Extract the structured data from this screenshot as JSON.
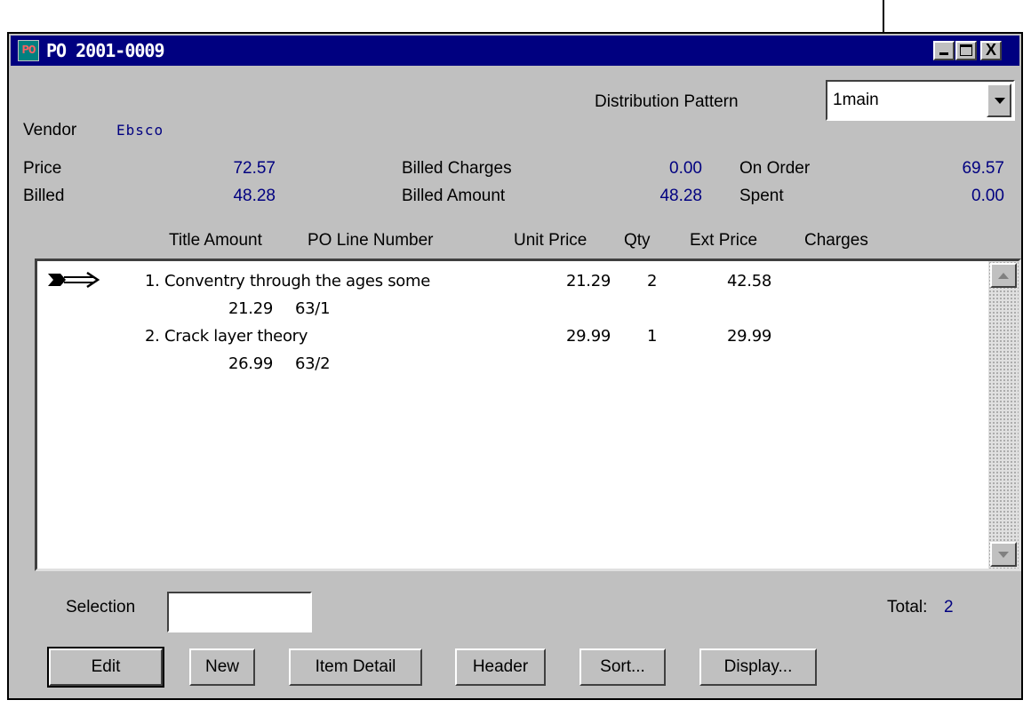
{
  "window": {
    "icon_text": "PO",
    "title": "PO 2001-0009",
    "close_glyph": "X"
  },
  "distribution": {
    "label": "Distribution Pattern",
    "value": "1main"
  },
  "vendor": {
    "label": "Vendor",
    "value": "Ebsco"
  },
  "summary": {
    "price_label": "Price",
    "price": "72.57",
    "billed_label": "Billed",
    "billed": "48.28",
    "billed_charges_label": "Billed Charges",
    "billed_charges": "0.00",
    "billed_amount_label": "Billed Amount",
    "billed_amount": "48.28",
    "on_order_label": "On Order",
    "on_order": "69.57",
    "spent_label": "Spent",
    "spent": "0.00"
  },
  "columns": {
    "title_amount": "Title Amount",
    "po_line": "PO Line Number",
    "unit_price": "Unit Price",
    "qty": "Qty",
    "ext_price": "Ext Price",
    "charges": "Charges"
  },
  "lines": [
    {
      "title": "1. Conventry through the ages some",
      "unit_price": "21.29",
      "qty": "2",
      "ext_price": "42.58",
      "amount": "21.29",
      "po_line": "63/1"
    },
    {
      "title": "2. Crack layer theory",
      "unit_price": "29.99",
      "qty": "1",
      "ext_price": "29.99",
      "amount": "26.99",
      "po_line": "63/2"
    }
  ],
  "selection": {
    "label": "Selection",
    "value": ""
  },
  "total": {
    "label": "Total:",
    "value": "2"
  },
  "buttons": {
    "edit": "Edit",
    "new": "New",
    "item_detail": "Item Detail",
    "header": "Header",
    "sort": "Sort...",
    "display": "Display..."
  },
  "colors": {
    "title_bar": "#000080",
    "value_text": "#000080",
    "window_bg": "#c0c0c0"
  }
}
